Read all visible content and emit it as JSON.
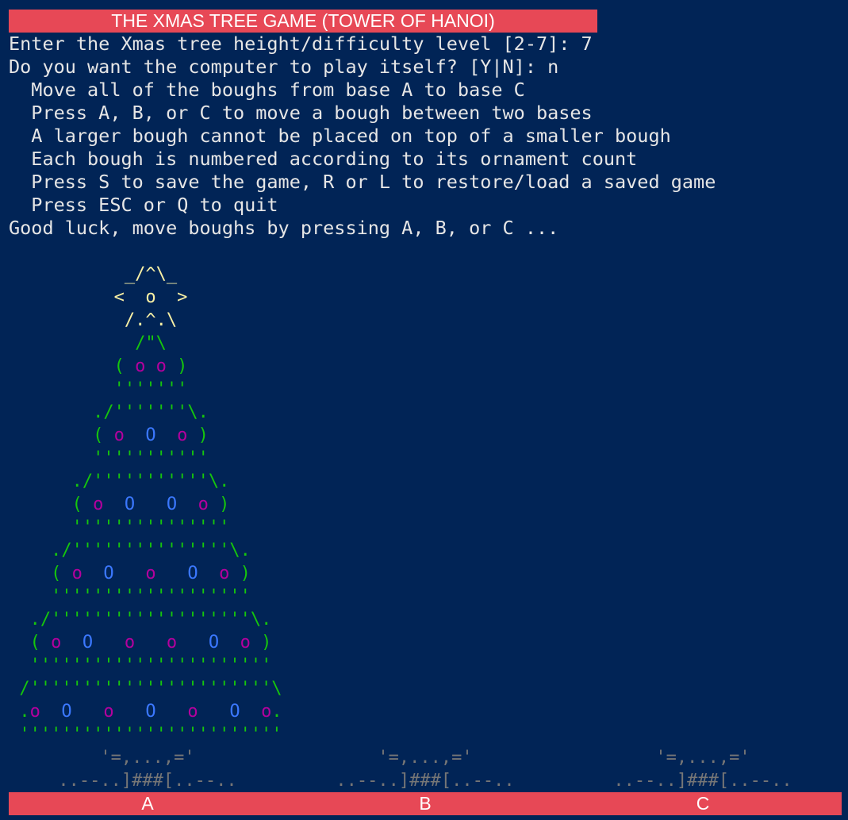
{
  "title": "THE XMAS TREE GAME (TOWER OF HANOI)",
  "prompts": [
    "Enter the Xmas tree height/difficulty level [2-7]: 7",
    "Do you want the computer to play itself? [Y|N]: n"
  ],
  "instructions": [
    "  Move all of the boughs from base A to base C",
    "  Press A, B, or C to move a bough between two bases",
    "  A larger bough cannot be placed on top of a smaller bough",
    "  Each bough is numbered according to its ornament count",
    "  Press S to save the game, R or L to restore/load a saved game",
    "  Press ESC or Q to quit"
  ],
  "status_line": "Good luck, move boughs by pressing A, B, or C ...",
  "tree_star": [
    "_/^\\_",
    "<  o  >",
    "/.^.\\"
  ],
  "bases": {
    "top": "'=,...,='",
    "bottom": "..--..]###[..--..",
    "labels": [
      "A",
      "B",
      "C"
    ]
  },
  "colors": {
    "background": "#012456",
    "bar": "#e74856",
    "star": "#f9f1a5",
    "bough": "#16c60c",
    "small_ornament": "#b4009e",
    "large_ornament": "#3b78ff",
    "base": "#767676"
  }
}
